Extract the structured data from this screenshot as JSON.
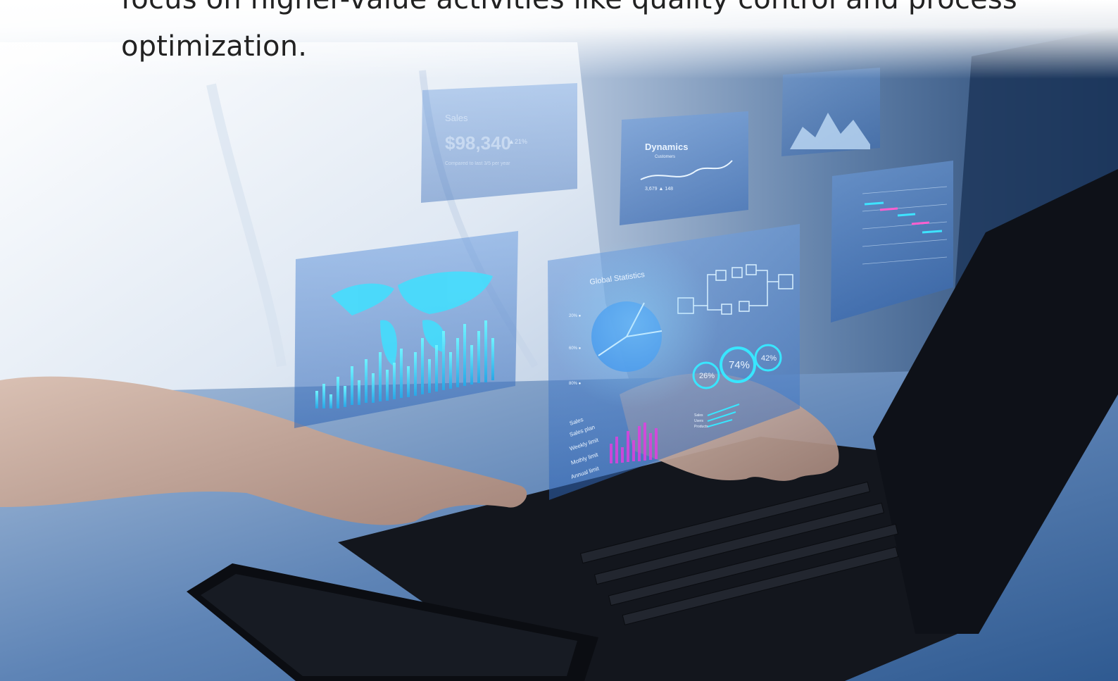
{
  "article": {
    "paragraph_lines": [
      "focus on higher-value activities like quality control and process",
      "optimization."
    ]
  },
  "hologram": {
    "sales_card": {
      "label": "Sales",
      "value": "$98,340",
      "delta": "▲21%",
      "note": "Compared to last 3/5 per year"
    },
    "dynamics_card": {
      "title": "Dynamics",
      "subtitle": "Customers",
      "value": "3,679 ▲ 148"
    },
    "global_stats": {
      "title": "Global Statistics",
      "axis_labels": [
        "20% ●",
        "60% ●",
        "80% ●"
      ],
      "legend": [
        "Sales",
        "Sales plan",
        "Weekly limit",
        "Mothly limit",
        "Annual limit"
      ],
      "rings": [
        "26%",
        "74%",
        "42%"
      ],
      "mini_legend": [
        "Sales",
        "Users",
        "Products"
      ]
    }
  },
  "colors": {
    "text": "#222222",
    "hologram_cyan": "#38e6ff",
    "hologram_blue": "#3d8ee8",
    "hologram_magenta": "#e040e0",
    "laptop": "#13161d"
  }
}
